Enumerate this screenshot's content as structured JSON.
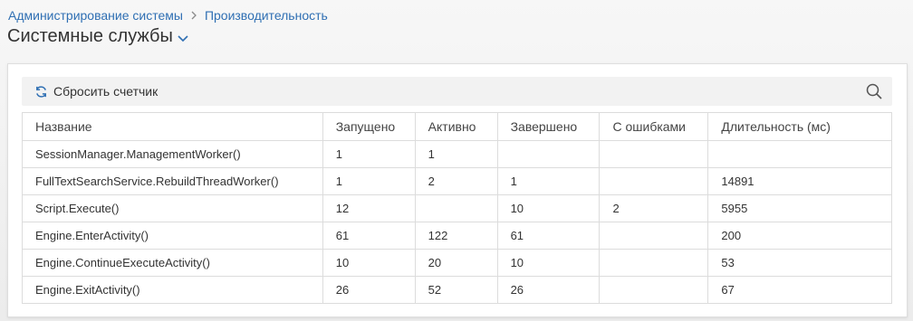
{
  "breadcrumb": {
    "parent": "Администрирование системы",
    "current": "Производительность"
  },
  "page_title": "Системные службы",
  "toolbar": {
    "reset_label": "Сбросить счетчик"
  },
  "table": {
    "columns": [
      "Название",
      "Запущено",
      "Активно",
      "Завершено",
      "С ошибками",
      "Длительность (мс)"
    ],
    "rows": [
      [
        "SessionManager.ManagementWorker()",
        "1",
        "1",
        "",
        "",
        ""
      ],
      [
        "FullTextSearchService.RebuildThreadWorker()",
        "1",
        "2",
        "1",
        "",
        "14891"
      ],
      [
        "Script.Execute()",
        "12",
        "",
        "10",
        "2",
        "5955"
      ],
      [
        "Engine.EnterActivity()",
        "61",
        "122",
        "61",
        "",
        "200"
      ],
      [
        "Engine.ContinueExecuteActivity()",
        "10",
        "20",
        "10",
        "",
        "53"
      ],
      [
        "Engine.ExitActivity()",
        "26",
        "52",
        "26",
        "",
        "67"
      ]
    ]
  },
  "colors": {
    "link": "#2f6fb3",
    "accent_icon": "#2f6fb3"
  }
}
